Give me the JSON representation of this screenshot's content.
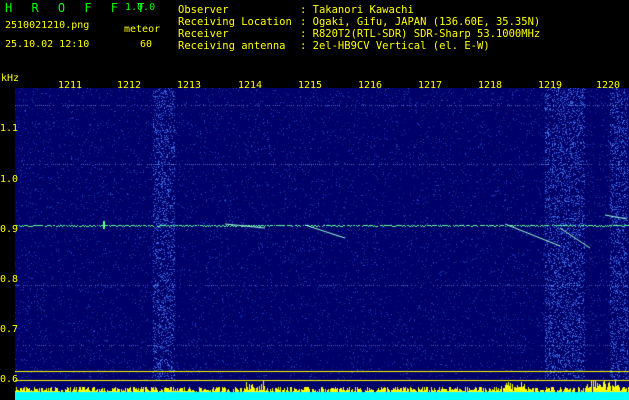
{
  "header": {
    "app_name": "H R O F F T",
    "version": "1.0.0",
    "filename": "2510021210.png",
    "mode_label": "meteor",
    "timestamp": "25.10.02 12:10",
    "count": "60",
    "info": [
      {
        "label": "Observer",
        "value": ": Takanori Kawachi"
      },
      {
        "label": "Receiving Location",
        "value": ": Ogaki, Gifu, JAPAN (136.60E, 35.35N)"
      },
      {
        "label": "Receiver",
        "value": ": R820T2(RTL-SDR) SDR-Sharp 53.1000MHz"
      },
      {
        "label": "Receiving antenna",
        "value": ": 2el-HB9CV Vertical (el. E-W)"
      }
    ]
  },
  "spectrogram": {
    "unit_label": "kHz",
    "time_ticks": [
      "1211",
      "1212",
      "1213",
      "1214",
      "1215",
      "1216",
      "1217",
      "1218",
      "1219",
      "1220"
    ],
    "freq_ticks": [
      "1.1",
      "1.0",
      "0.9",
      "0.8",
      "0.7",
      "0.6"
    ],
    "colors": {
      "background": "#00006a",
      "noise": "#1030c0",
      "carrier": "#60ff90",
      "meteor": "#9fffd0",
      "baseline": "#ffff00",
      "floor": "#00ffff"
    }
  }
}
